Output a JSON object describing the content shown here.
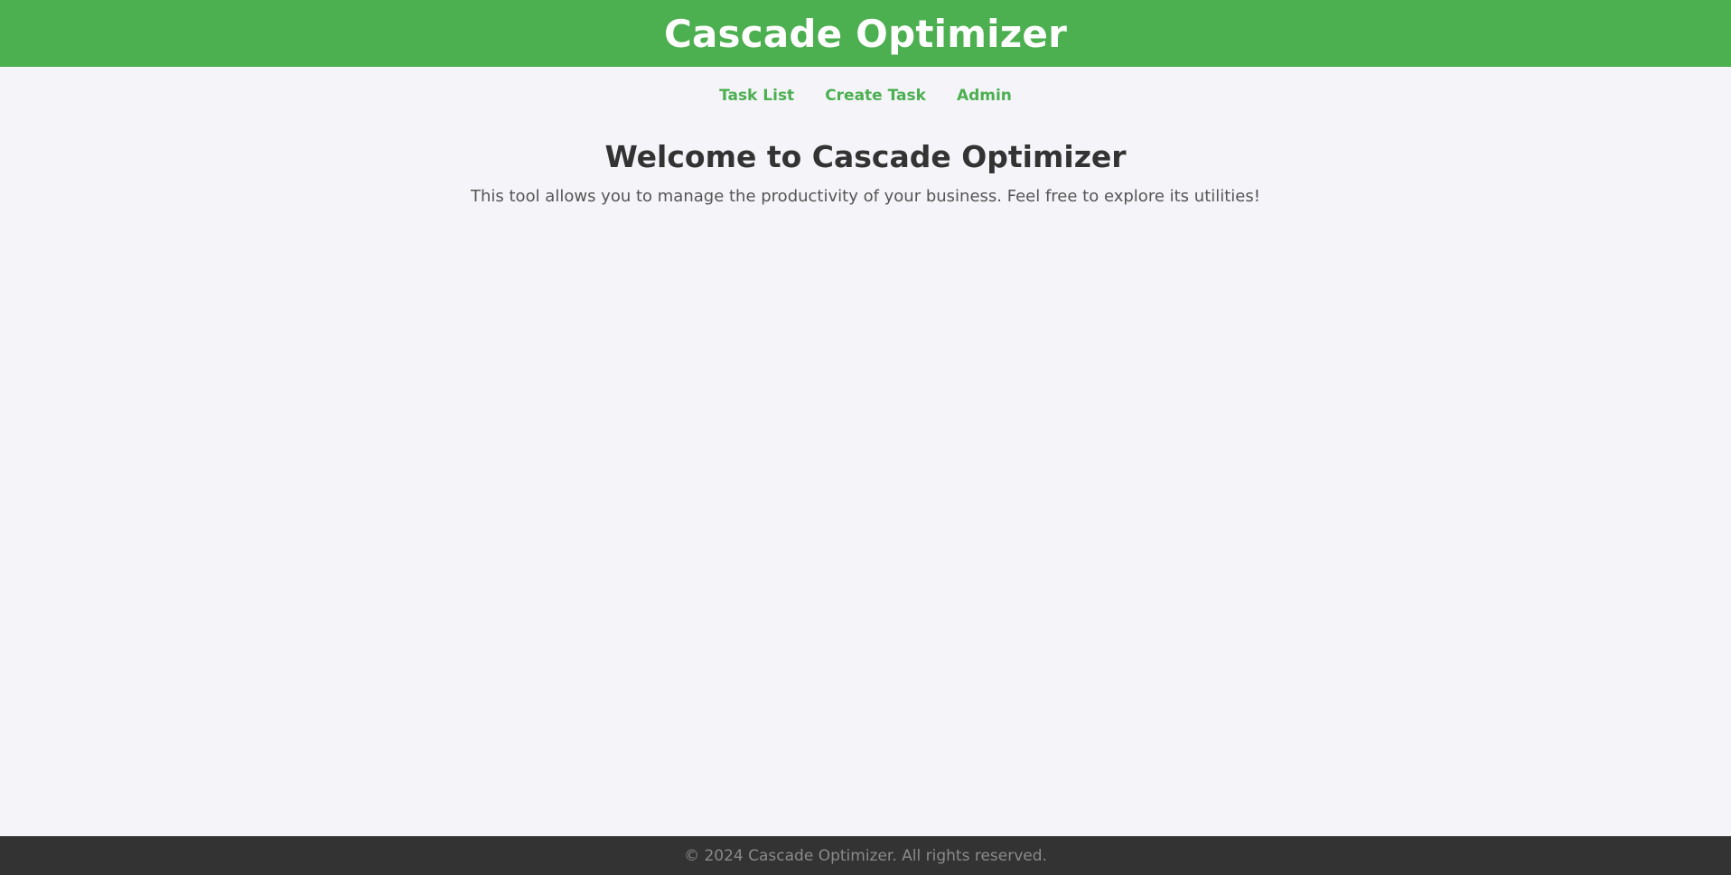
{
  "header": {
    "title": "Cascade Optimizer"
  },
  "nav": {
    "items": [
      {
        "label": "Task List"
      },
      {
        "label": "Create Task"
      },
      {
        "label": "Admin"
      }
    ]
  },
  "main": {
    "heading": "Welcome to Cascade Optimizer",
    "description": "This tool allows you to manage the productivity of your business. Feel free to explore its utilities!"
  },
  "footer": {
    "text": "© 2024 Cascade Optimizer. All rights reserved."
  },
  "colors": {
    "brand": "#4caf50",
    "background": "#f4f4f9",
    "footer": "#333333"
  }
}
